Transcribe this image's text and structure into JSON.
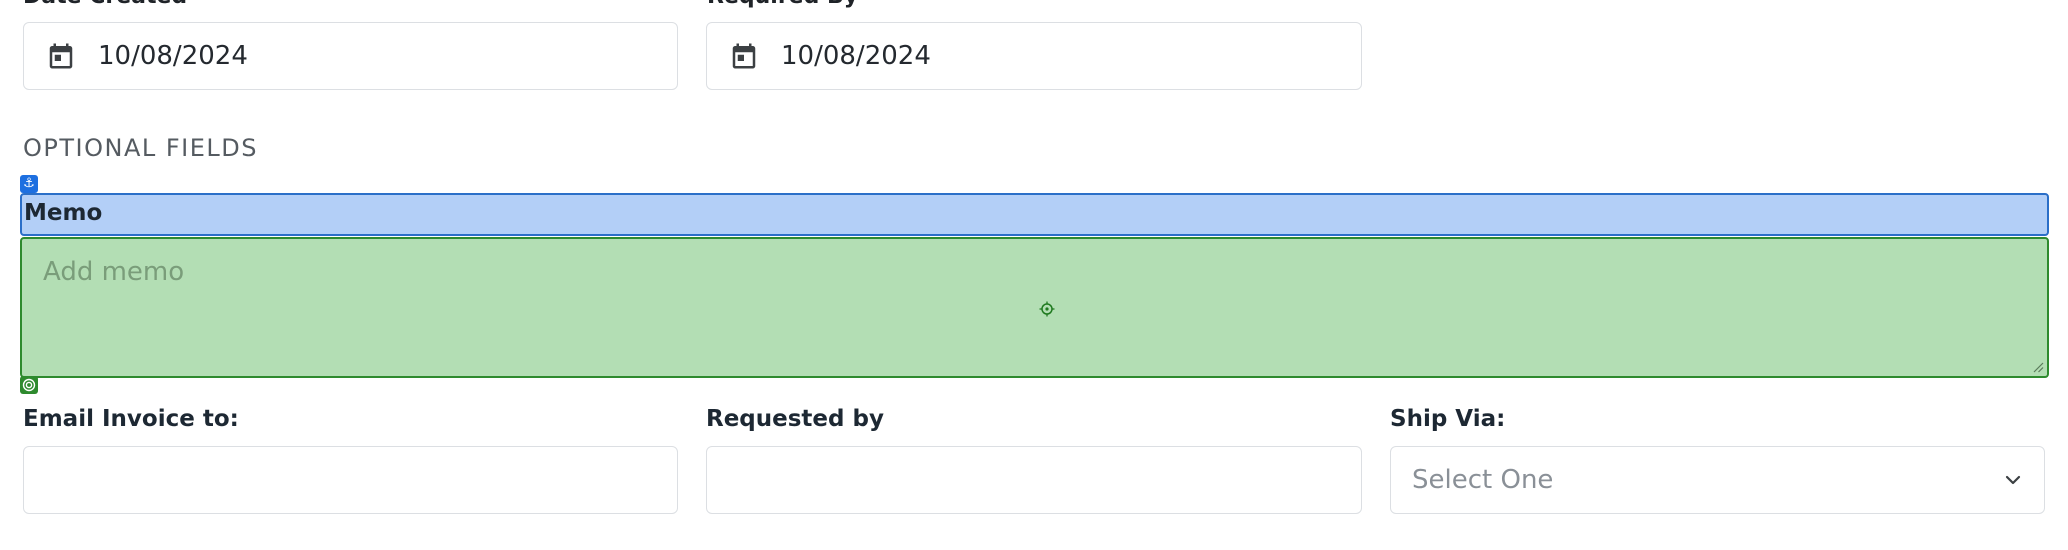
{
  "date_created": {
    "label": "Date Created",
    "value": "10/08/2024",
    "icon": "calendar-icon"
  },
  "required_by": {
    "label": "Required By",
    "value": "10/08/2024",
    "icon": "calendar-icon"
  },
  "optional_section": {
    "title": "OPTIONAL FIELDS"
  },
  "memo": {
    "label": "Memo",
    "placeholder": "Add memo"
  },
  "email_invoice": {
    "label": "Email Invoice to:",
    "value": ""
  },
  "requested_by": {
    "label": "Requested by",
    "value": ""
  },
  "ship_via": {
    "label": "Ship Via:",
    "placeholder": "Select One",
    "icon": "chevron-down-icon"
  },
  "colors": {
    "memo_highlight": "#b3cff7",
    "memo_area_highlight": "#b3deb4",
    "anchor_badge": "#1d6fe0",
    "target_badge": "#2e8a2e"
  }
}
